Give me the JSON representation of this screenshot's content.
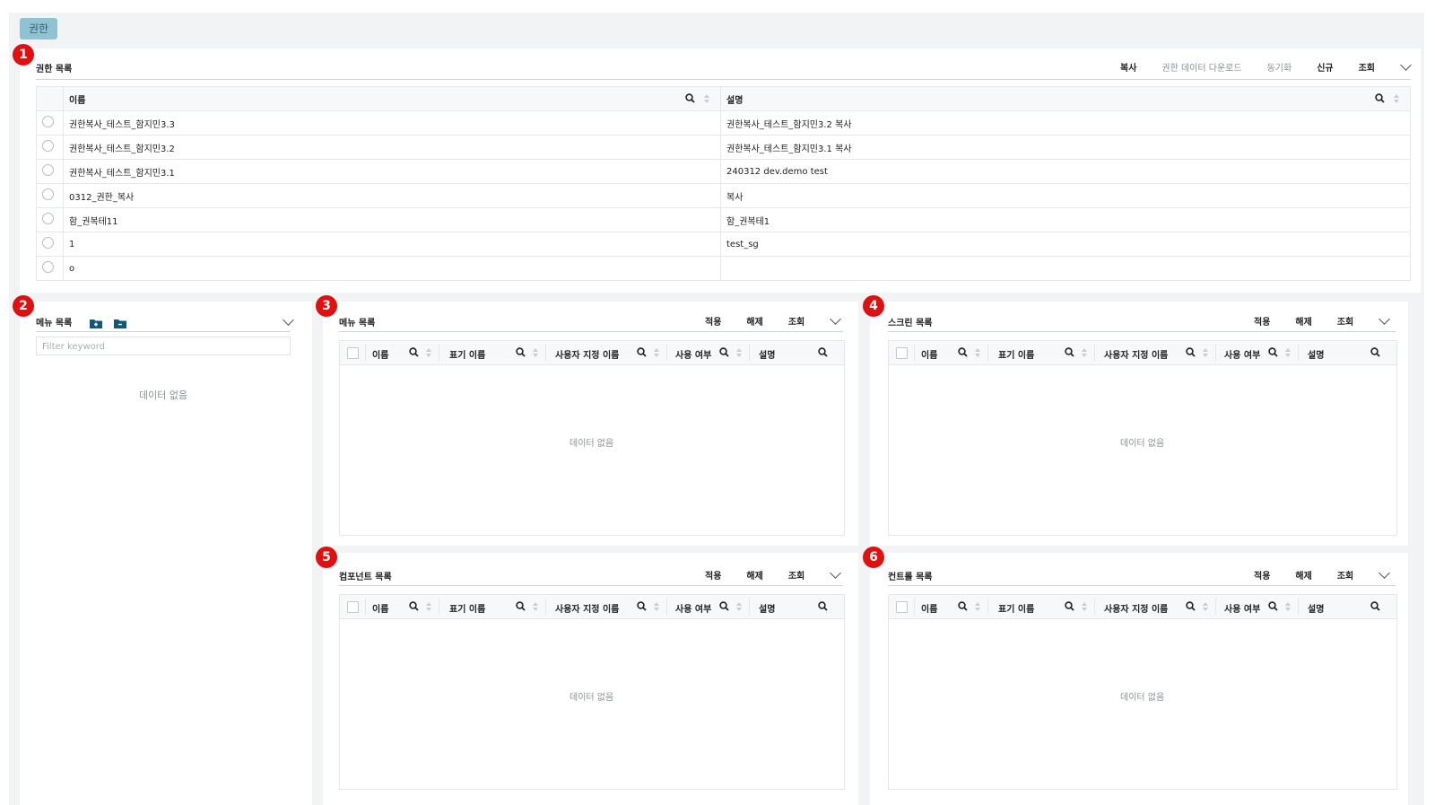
{
  "tab": {
    "label": "권한"
  },
  "badges": [
    "1",
    "2",
    "3",
    "4",
    "5",
    "6"
  ],
  "role_list": {
    "title": "권한 목록",
    "actions": {
      "copy": "복사",
      "download": "권한 데이터 다운로드",
      "sync": "동기화",
      "new": "신규",
      "search": "조회"
    },
    "columns": {
      "name": "이름",
      "desc": "설명"
    },
    "rows": [
      {
        "name": "권한복사_테스트_함지민3.3",
        "desc": "권한복사_테스트_함지민3.2 복사"
      },
      {
        "name": "권한복사_테스트_함지민3.2",
        "desc": "권한복사_테스트_함지민3.1 복사"
      },
      {
        "name": "권한복사_테스트_함지민3.1",
        "desc": "240312 dev.demo test"
      },
      {
        "name": "0312_권한_복사",
        "desc": "복사"
      },
      {
        "name": "함_권복테11",
        "desc": "함_권복테1"
      },
      {
        "name": "1",
        "desc": "test_sg"
      },
      {
        "name": "o",
        "desc": ""
      }
    ]
  },
  "menu_tree": {
    "title": "메뉴 목록",
    "filter_placeholder": "Filter keyword",
    "empty": "데이터 없음"
  },
  "grids": {
    "actions": {
      "apply": "적용",
      "release": "해제",
      "search": "조회"
    },
    "columns": {
      "name": "이름",
      "display": "표기 이름",
      "custom": "사용자 지정 이름",
      "use": "사용 여부",
      "desc": "설명"
    },
    "empty": "데이터 없음",
    "menu": {
      "title": "메뉴 목록"
    },
    "screen": {
      "title": "스크린 목록"
    },
    "component": {
      "title": "컴포넌트 목록"
    },
    "control": {
      "title": "컨트롤 목록"
    }
  }
}
